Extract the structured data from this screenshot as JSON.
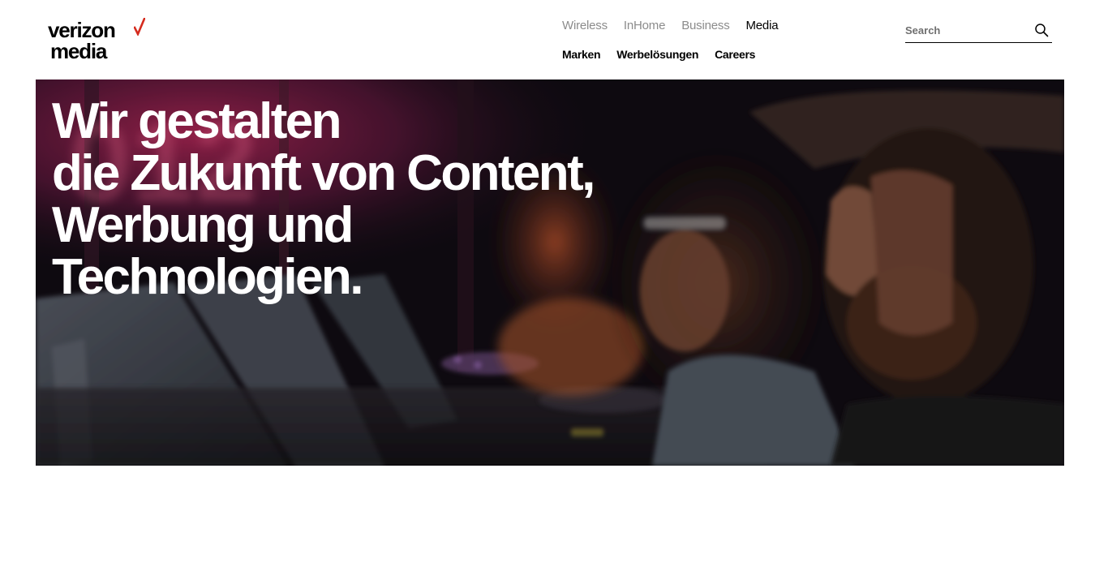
{
  "logo": {
    "line1": "verizon",
    "line2": "media",
    "check_color": "#d52b1e"
  },
  "top_nav": [
    {
      "label": "Wireless",
      "active": false
    },
    {
      "label": "InHome",
      "active": false
    },
    {
      "label": "Business",
      "active": false
    },
    {
      "label": "Media",
      "active": true
    }
  ],
  "sub_nav": [
    {
      "label": "Marken"
    },
    {
      "label": "Werbelösungen"
    },
    {
      "label": "Careers"
    }
  ],
  "search": {
    "placeholder": "Search",
    "value": "",
    "icon": "search-icon"
  },
  "hero": {
    "title_lines": [
      "Wir gestalten",
      "die Zukunft von Content,",
      "Werbung und",
      "Technologien."
    ]
  },
  "colors": {
    "accent": "#d52b1e",
    "nav_inactive": "#8c8c8c",
    "text": "#000000"
  }
}
